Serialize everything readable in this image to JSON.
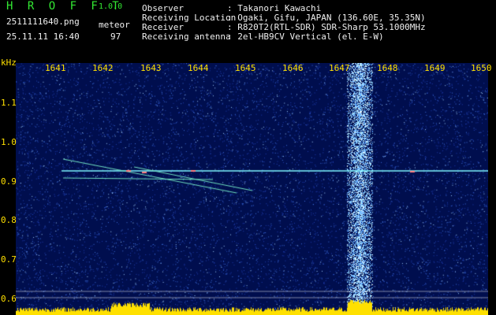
{
  "header": {
    "logo": "H R O F F T",
    "version": "1.0.0",
    "filename": "2511111640.png",
    "datetime": "25.11.11 16:40",
    "event_type": "meteor",
    "event_count": "97",
    "meta": [
      {
        "label": "Observer",
        "value": ": Takanori Kawachi"
      },
      {
        "label": "Receiving Location",
        "value": ": Ogaki, Gifu, JAPAN (136.60E, 35.35N)"
      },
      {
        "label": "Receiver",
        "value": ": R820T2(RTL-SDR) SDR-Sharp 53.1000MHz"
      },
      {
        "label": "Receiving antenna",
        "value": ": 2el-HB9CV Vertical (el. E-W)"
      }
    ]
  },
  "axis": {
    "unit": "kHz",
    "freq_labels": [
      "1641",
      "1642",
      "1643",
      "1644",
      "1645",
      "1646",
      "1647",
      "1648",
      "1649",
      "1650"
    ],
    "amp_labels": [
      "1.1",
      "1.0",
      "0.9",
      "0.8",
      "0.7",
      "0.6"
    ]
  },
  "colors": {
    "background": "#000e4e",
    "header_green": "#33e833",
    "axis_yellow": "#ffe000",
    "signal_cyan": "#7ff8ff"
  }
}
